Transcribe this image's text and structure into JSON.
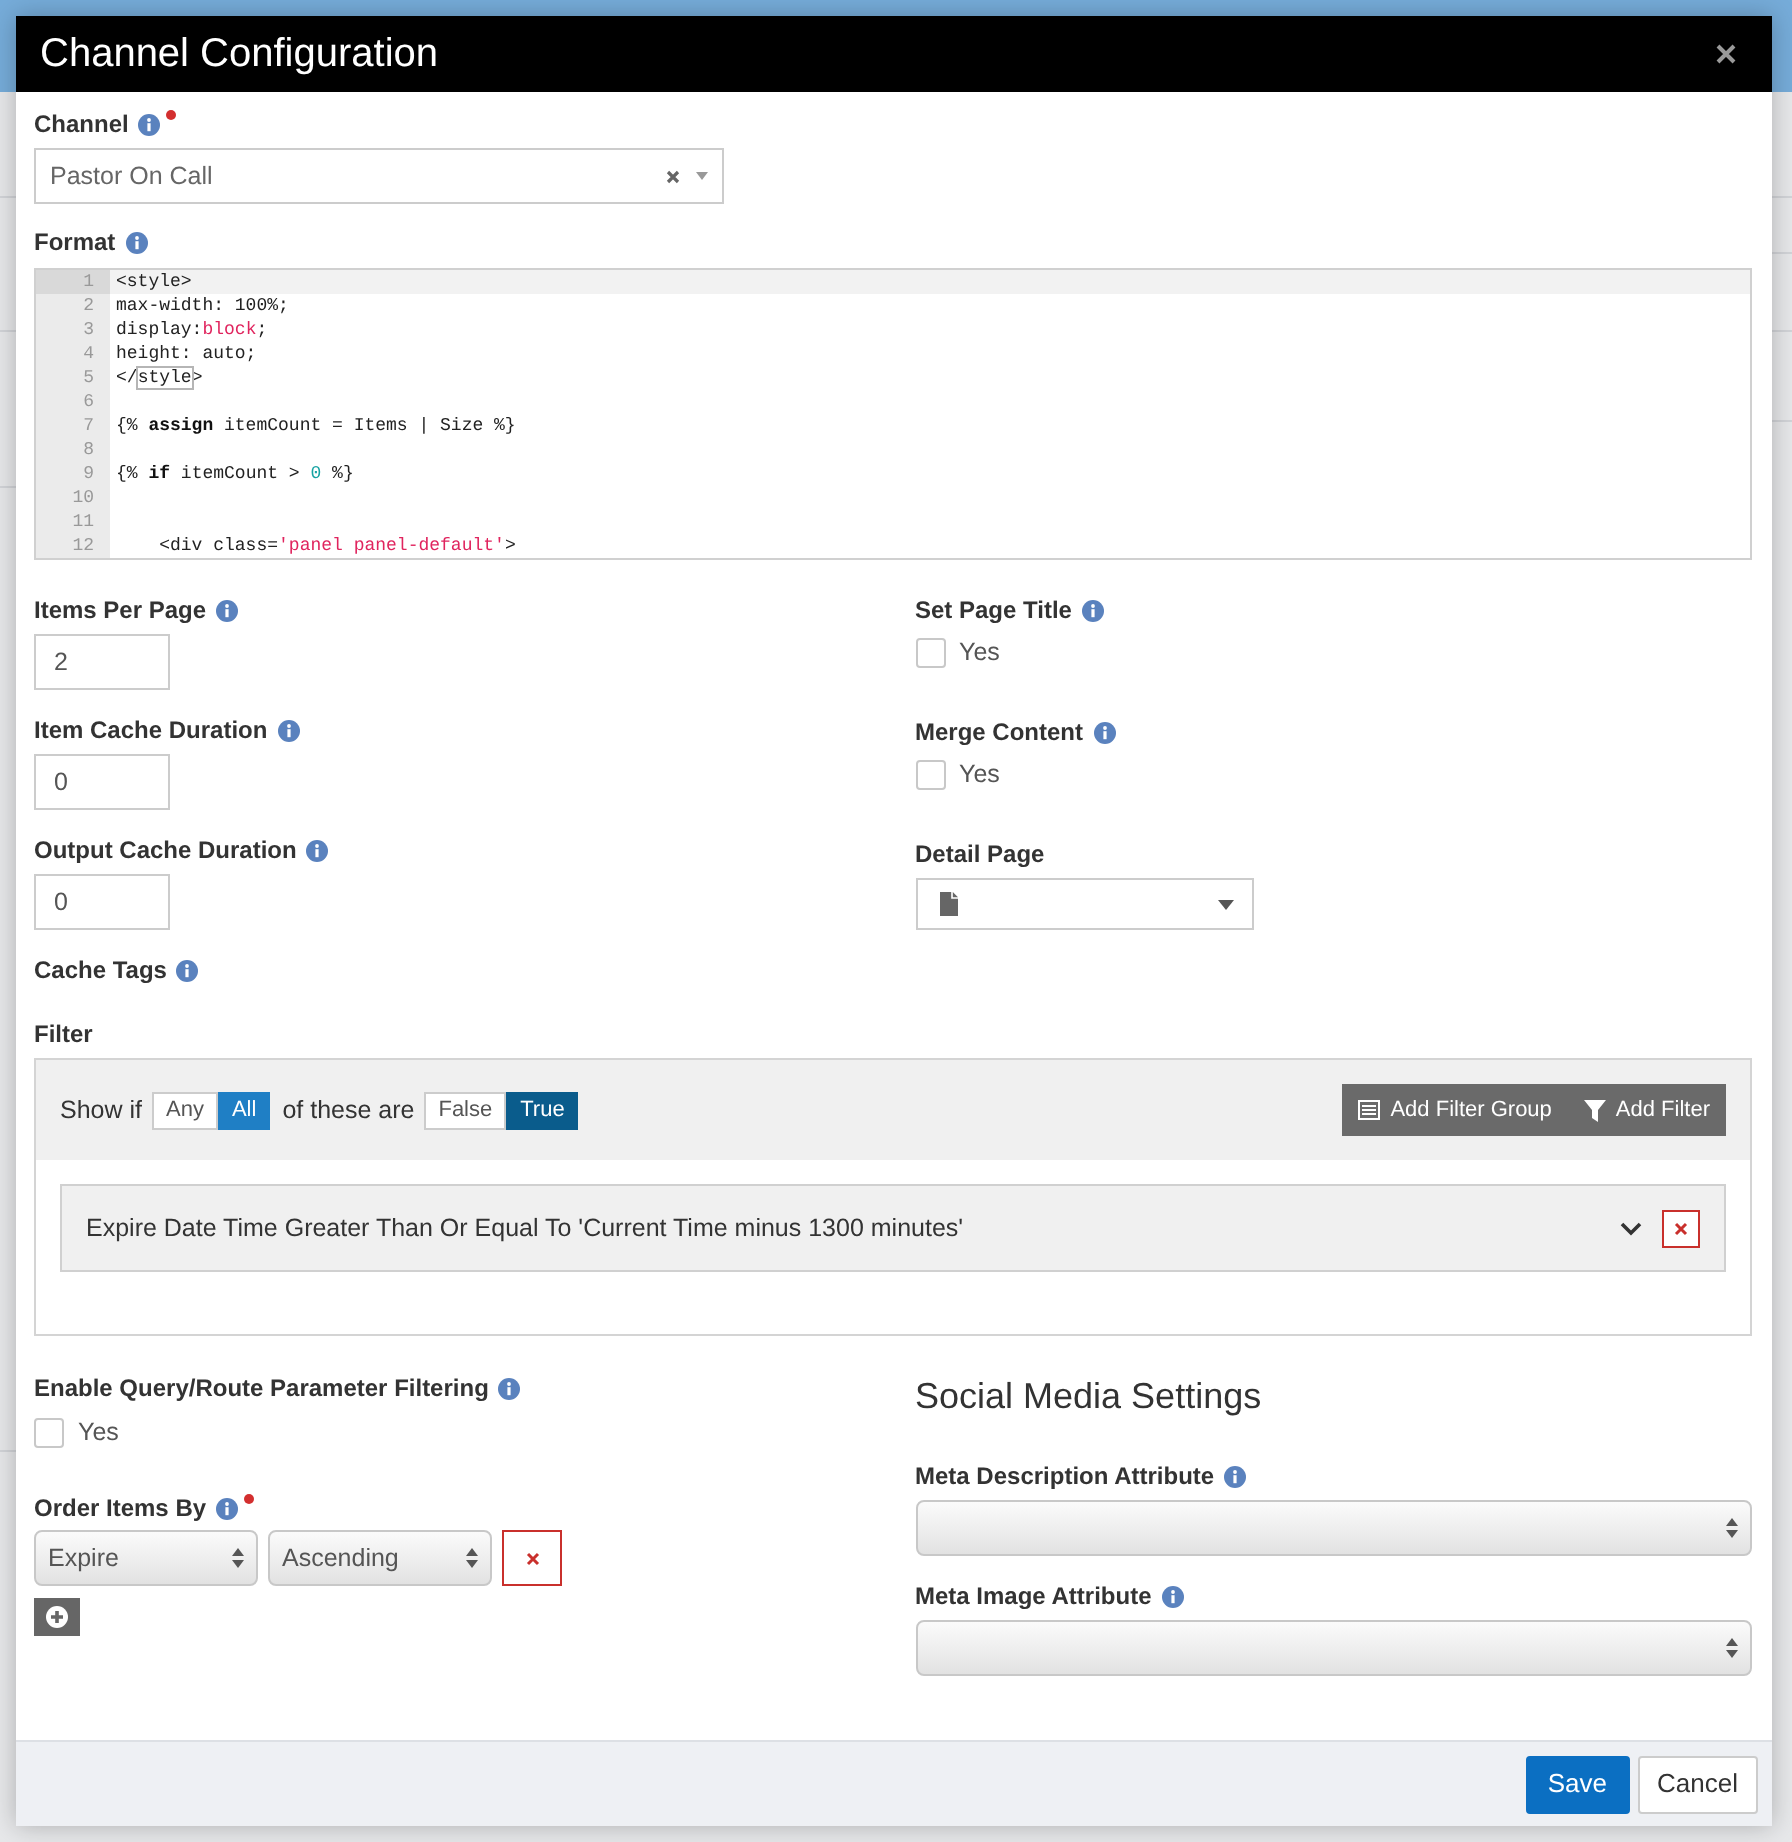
{
  "window": {
    "title": "Channel Configuration"
  },
  "channel": {
    "label": "Channel",
    "help": true,
    "required": true,
    "value": "Pastor On Call"
  },
  "format": {
    "label": "Format",
    "help": true,
    "lines": [
      {
        "number": "1",
        "active": true,
        "tokens": [
          {
            "kind": "plain",
            "text": "<style>"
          }
        ]
      },
      {
        "number": "2",
        "active": false,
        "tokens": [
          {
            "kind": "plain",
            "text": "max-width: 100%;"
          }
        ]
      },
      {
        "number": "3",
        "active": false,
        "tokens": [
          {
            "kind": "plain",
            "text": "display:"
          },
          {
            "kind": "string",
            "text": "block"
          },
          {
            "kind": "plain",
            "text": ";"
          }
        ]
      },
      {
        "number": "4",
        "active": false,
        "tokens": [
          {
            "kind": "plain",
            "text": "height: auto;"
          }
        ]
      },
      {
        "number": "5",
        "active": false,
        "tokens": [
          {
            "kind": "plain",
            "text": "</"
          },
          {
            "kind": "match",
            "text": "style"
          },
          {
            "kind": "plain",
            "text": ">"
          }
        ]
      },
      {
        "number": "6",
        "active": false
      },
      {
        "number": "7",
        "active": false,
        "tokens": [
          {
            "kind": "plain",
            "text": "{% "
          },
          {
            "kind": "keyword",
            "text": "assign"
          },
          {
            "kind": "plain",
            "text": " itemCount = Items | Size %}"
          }
        ]
      },
      {
        "number": "8",
        "active": false
      },
      {
        "number": "9",
        "active": false,
        "tokens": [
          {
            "kind": "plain",
            "text": "{% "
          },
          {
            "kind": "keyword",
            "text": "if"
          },
          {
            "kind": "plain",
            "text": " itemCount > "
          },
          {
            "kind": "number",
            "text": "0"
          },
          {
            "kind": "plain",
            "text": " %}"
          }
        ]
      },
      {
        "number": "10",
        "active": false
      },
      {
        "number": "11",
        "active": false
      },
      {
        "number": "12",
        "active": false,
        "tokens": [
          {
            "kind": "plain",
            "text": "    <div class="
          },
          {
            "kind": "string",
            "text": "'panel panel-default'"
          },
          {
            "kind": "plain",
            "text": ">"
          }
        ]
      }
    ]
  },
  "settings_left": [
    {
      "kind": "text",
      "label": "Items Per Page",
      "help": true,
      "value": "2"
    },
    {
      "kind": "text",
      "label": "Item Cache Duration",
      "help": true,
      "value": "0"
    },
    {
      "kind": "text",
      "label": "Output Cache Duration",
      "help": true,
      "value": "0"
    },
    {
      "kind": "tags",
      "label": "Cache Tags",
      "help": true
    }
  ],
  "settings_right": [
    {
      "kind": "checkbox",
      "label": "Set Page Title",
      "help": true,
      "option": "Yes",
      "checked": false
    },
    {
      "kind": "checkbox",
      "label": "Merge Content",
      "help": true,
      "option": "Yes",
      "checked": false
    },
    {
      "kind": "page_picker",
      "label": "Detail Page"
    }
  ],
  "filter": {
    "label": "Filter",
    "show_if": "Show if",
    "match": [
      {
        "label": "Any",
        "selected": false
      },
      {
        "label": "All",
        "selected": true
      }
    ],
    "of_these_are": "of these are",
    "truth": [
      {
        "label": "False",
        "selected": false
      },
      {
        "label": "True",
        "selected": true
      }
    ],
    "actions": [
      {
        "kind": "group",
        "label": "Add Filter Group"
      },
      {
        "kind": "filter",
        "label": "Add Filter"
      }
    ],
    "rules": [
      {
        "text": "Expire Date Time Greater Than Or Equal To 'Current Time minus 1300 minutes'",
        "expanded": false
      }
    ]
  },
  "query_filtering": {
    "label": "Enable Query/Route Parameter Filtering",
    "help": true,
    "option": "Yes",
    "checked": false
  },
  "order_items_by": {
    "label": "Order Items By",
    "help": true,
    "required": true,
    "rows": [
      {
        "field": "Expire",
        "direction": "Ascending"
      }
    ]
  },
  "social_media": {
    "title": "Social Media Settings",
    "fields": [
      {
        "label": "Meta Description Attribute",
        "help": true
      },
      {
        "label": "Meta Image Attribute",
        "help": true
      }
    ]
  },
  "footer": {
    "buttons": [
      {
        "kind": "primary",
        "label": "Save"
      },
      {
        "kind": "secondary",
        "label": "Cancel"
      }
    ]
  }
}
